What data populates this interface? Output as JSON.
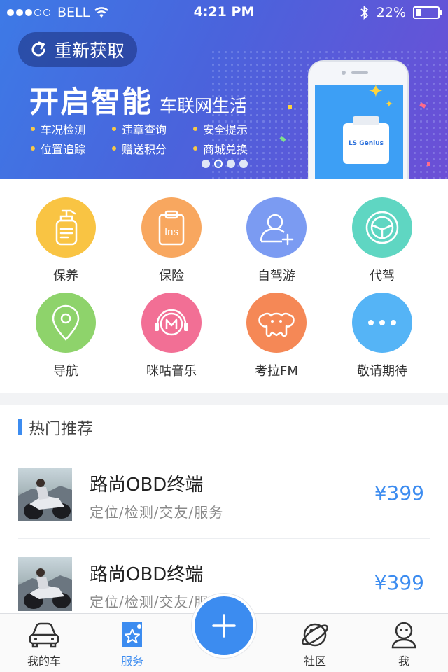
{
  "status_bar": {
    "carrier": "BELL",
    "time": "4:21 PM",
    "battery": "22%",
    "battery_level": 0.22
  },
  "banner": {
    "refresh_label": "重新获取",
    "title_big": "开启智能",
    "title_small": "车联网生活",
    "features": [
      "车况检测",
      "违章查询",
      "安全提示",
      "位置追踪",
      "赠送积分",
      "商城兑换"
    ],
    "device_label": "LS Genius",
    "page_count": 4,
    "active_page": 2
  },
  "services": [
    {
      "label": "保养",
      "icon": "lotion-bottle-icon",
      "color": "#f9c443"
    },
    {
      "label": "保险",
      "icon": "insurance-clipboard-icon",
      "color": "#f8a75f"
    },
    {
      "label": "自驾游",
      "icon": "user-add-icon",
      "color": "#7b9bf2"
    },
    {
      "label": "代驾",
      "icon": "steering-wheel-icon",
      "color": "#5fd6c2"
    },
    {
      "label": "导航",
      "icon": "location-pin-icon",
      "color": "#8ed36b"
    },
    {
      "label": "咪咕音乐",
      "icon": "music-headphones-icon",
      "color": "#f26f95"
    },
    {
      "label": "考拉FM",
      "icon": "koala-icon",
      "color": "#f58856"
    },
    {
      "label": "敬请期待",
      "icon": "more-dots-icon",
      "color": "#55b4f6"
    }
  ],
  "hot": {
    "title": "热门推荐",
    "products": [
      {
        "name": "路尚OBD终端",
        "desc": "定位/检测/交友/服务",
        "price": "¥399"
      },
      {
        "name": "路尚OBD终端",
        "desc": "定位/检测/交友/服务",
        "price": "¥399"
      }
    ]
  },
  "tabbar": {
    "tabs": [
      {
        "label": "我的车",
        "icon": "car-icon"
      },
      {
        "label": "服务",
        "icon": "service-ticket-icon"
      },
      {
        "label": "社区",
        "icon": "planet-icon"
      },
      {
        "label": "我",
        "icon": "profile-icon"
      }
    ],
    "active": "服务",
    "fab_icon": "plus-icon"
  },
  "colors": {
    "accent": "#3c8cf0",
    "banner_start": "#3d7ae6",
    "banner_end": "#6c4fd6"
  }
}
